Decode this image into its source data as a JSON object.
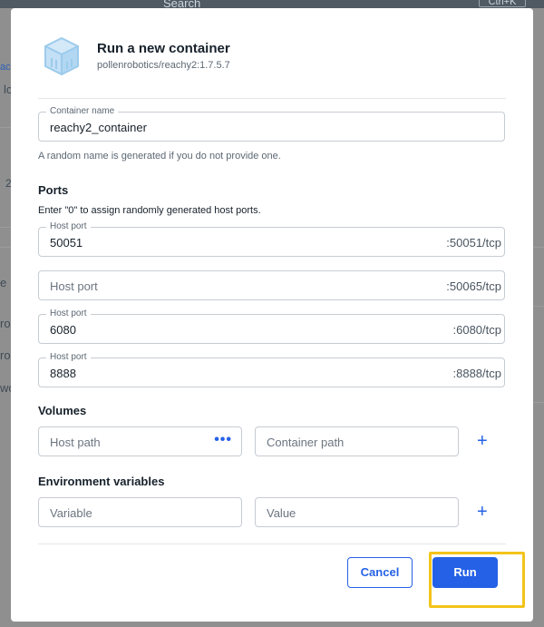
{
  "background": {
    "search_label": "Search",
    "search_shortcut": "Ctrl+K",
    "fragments": [
      "aci",
      "lc",
      "2",
      "e",
      "ro",
      "ro",
      "wo"
    ]
  },
  "dialog": {
    "title": "Run a new container",
    "image": "pollenrobotics/reachy2:1.7.5.7",
    "container_name": {
      "label": "Container name",
      "value": "reachy2_container",
      "helper": "A random name is generated if you do not provide one."
    },
    "ports": {
      "heading": "Ports",
      "helper": "Enter \"0\" to assign randomly generated host ports.",
      "items": [
        {
          "label": "Host port",
          "value": "50051",
          "placeholder": "",
          "container_port": ":50051/tcp"
        },
        {
          "label": "",
          "value": "",
          "placeholder": "Host port",
          "container_port": ":50065/tcp"
        },
        {
          "label": "Host port",
          "value": "6080",
          "placeholder": "",
          "container_port": ":6080/tcp"
        },
        {
          "label": "Host port",
          "value": "8888",
          "placeholder": "",
          "container_port": ":8888/tcp"
        }
      ]
    },
    "volumes": {
      "heading": "Volumes",
      "host_path_placeholder": "Host path",
      "container_path_placeholder": "Container path",
      "browse_icon": "more-horizontal-icon",
      "add_icon": "plus-icon"
    },
    "env": {
      "heading": "Environment variables",
      "variable_placeholder": "Variable",
      "value_placeholder": "Value",
      "add_icon": "plus-icon"
    },
    "buttons": {
      "cancel": "Cancel",
      "run": "Run"
    }
  },
  "colors": {
    "accent": "#2561e6",
    "highlight": "#f3c41a",
    "overlay": "#8f8f8f"
  }
}
